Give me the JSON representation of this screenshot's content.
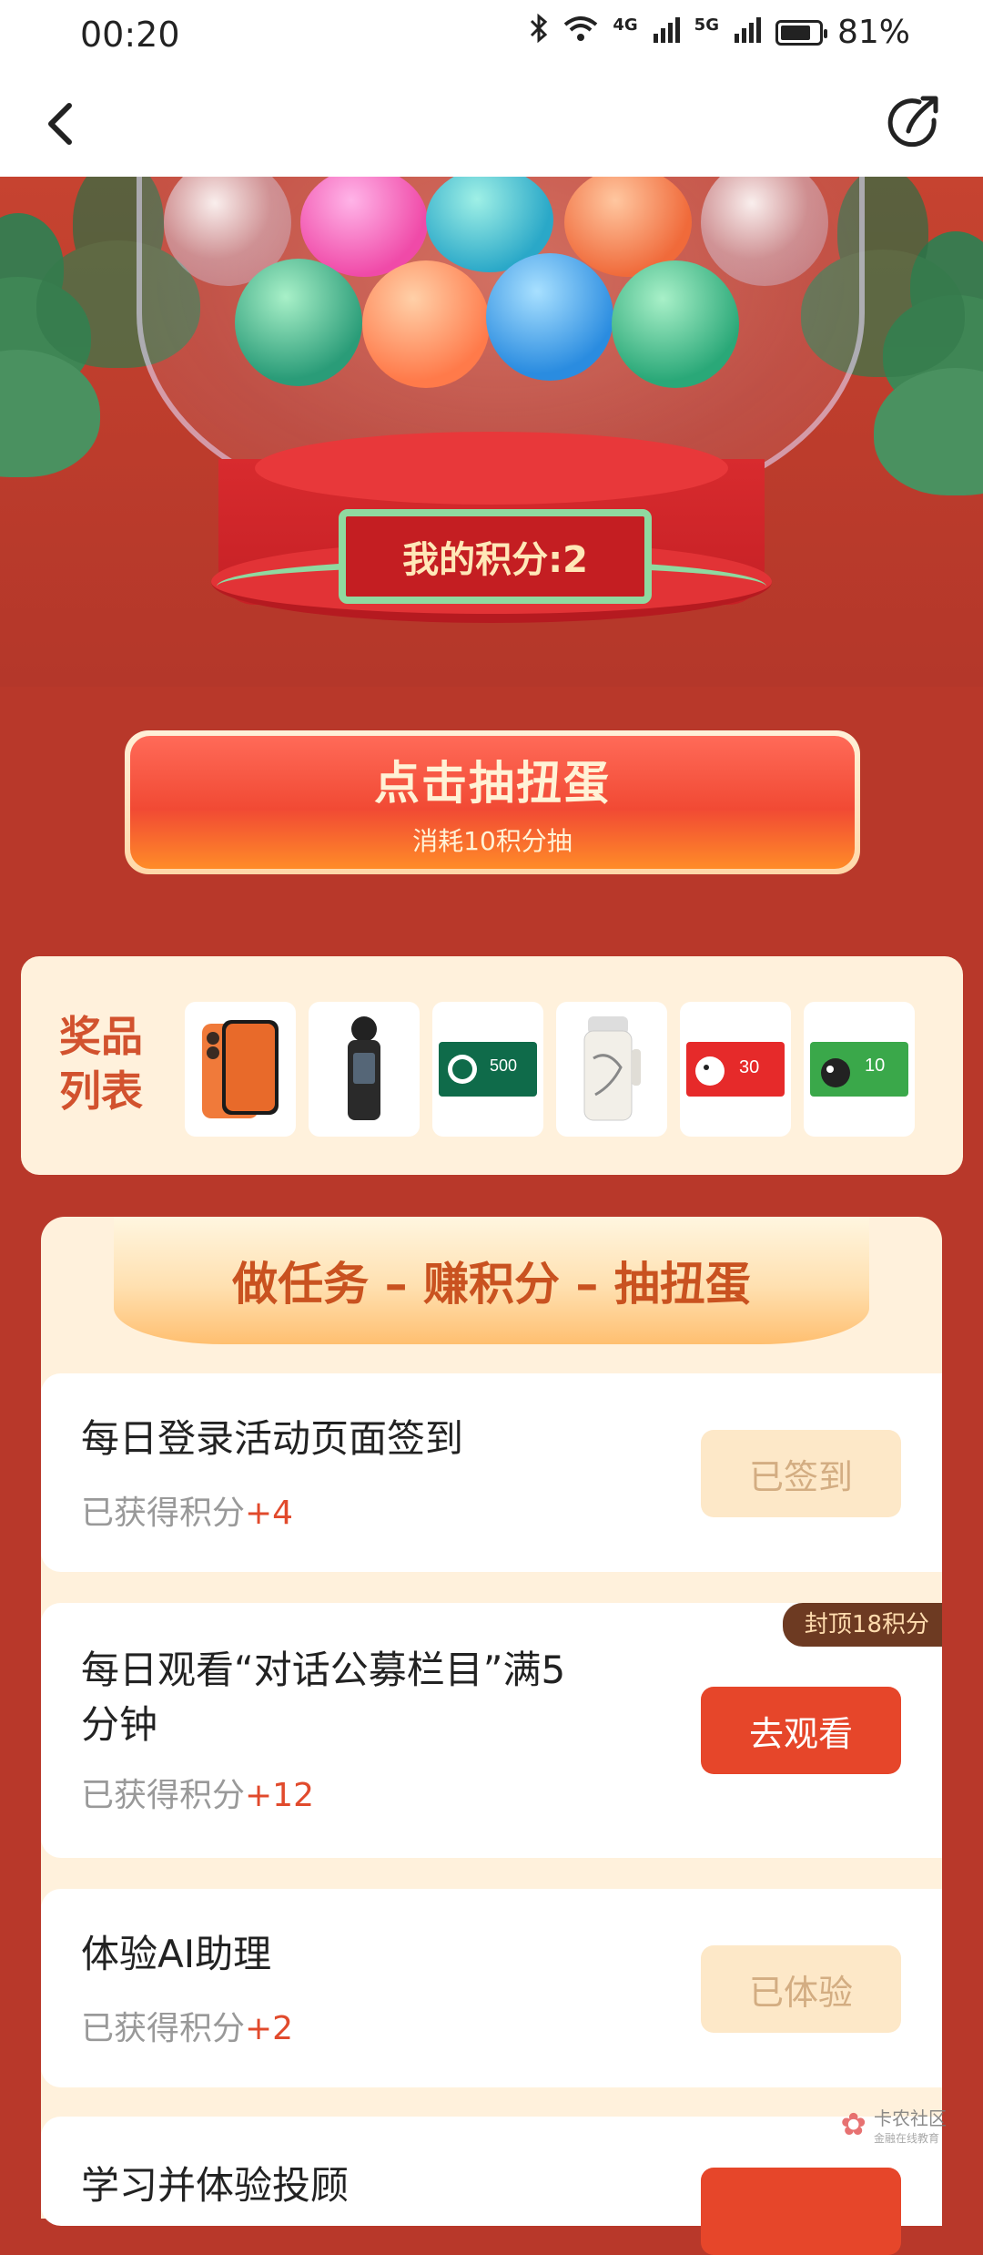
{
  "status_bar": {
    "time": "00:20",
    "net_left": "4G",
    "net_right": "5G",
    "battery": "81%",
    "battery_level": 0.81,
    "icons": [
      "bluetooth-icon",
      "wifi-icon",
      "signal-icon",
      "signal-icon",
      "battery-icon"
    ]
  },
  "nav": {
    "back_icon": "chevron-left-icon",
    "share_icon": "share-icon"
  },
  "hero": {
    "score_label": "我的积分:2"
  },
  "draw_button": {
    "title": "点击抽扭蛋",
    "subtitle": "消耗10积分抽"
  },
  "prizes": {
    "label": "奖品列表",
    "items": [
      {
        "name": "phone"
      },
      {
        "name": "handheld-camera"
      },
      {
        "name": "starbucks-card",
        "value": "500"
      },
      {
        "name": "thermos-cup"
      },
      {
        "name": "jd-card",
        "value": "30"
      },
      {
        "name": "tmall-card",
        "value": "10"
      }
    ]
  },
  "tasks": {
    "banner": "做任务 – 赚积分 – 抽扭蛋",
    "items": [
      {
        "title": "每日登录活动页面签到",
        "pts_label": "已获得积分",
        "pts_value": "+4",
        "button": "已签到"
      },
      {
        "title_line1": "每日观看“对话公募栏目”满5",
        "title_line2": "分钟",
        "pts_label": "已获得积分",
        "pts_value": "+12",
        "button": "去观看",
        "tag": "封顶18积分"
      },
      {
        "title": "体验AI助理",
        "pts_label": "已获得积分",
        "pts_value": "+2",
        "button": "已体验"
      },
      {
        "title": "学习并体验投顾"
      }
    ]
  },
  "watermark": {
    "line1": "卡农社区",
    "line2": "金融在线教育"
  },
  "colors": {
    "page_bg": "#b8382a",
    "accent": "#e6462a",
    "card_bg": "#fff1dc",
    "prize_label": "#d2522e"
  }
}
